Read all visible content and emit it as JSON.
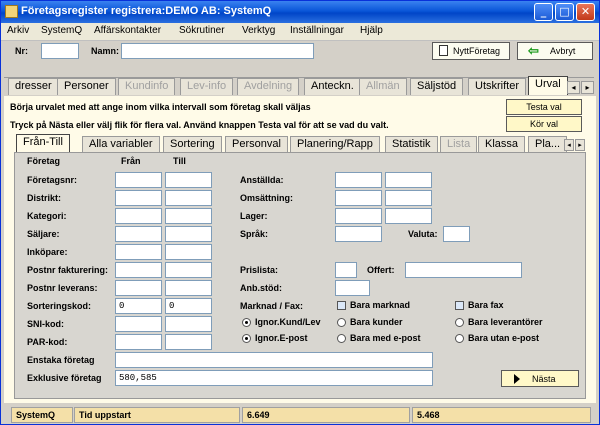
{
  "window": {
    "title": "Företagsregister registrera:DEMO AB: SystemQ"
  },
  "menu": [
    "Arkiv",
    "SystemQ",
    "Affärskontakter",
    "Sökrutiner",
    "Verktyg",
    "Inställningar",
    "Hjälp"
  ],
  "toolbar": {
    "nr_label": "Nr:",
    "namn_label": "Namn:",
    "nytt_label": "NyttFöretag",
    "avbryt_label": "Avbryt"
  },
  "main_tabs": [
    "dresser",
    "Personer",
    "Kundinfo",
    "Lev-info",
    "Avdelning",
    "Anteckn.",
    "Allmän",
    "Säljstöd",
    "Utskrifter",
    "Urval"
  ],
  "info": {
    "line1": "Börja urvalet med att ange inom vilka intervall som företag skall väljas",
    "line2": "Tryck på Nästa eller välj flik för flera val. Använd knappen Testa val för att se vad du valt.",
    "testa_label": "Testa val",
    "kor_label": "Kör val"
  },
  "sub_tabs": [
    "Från-Till",
    "Alla variabler",
    "Sortering",
    "Personval",
    "Planering/Rapp",
    "Statistik",
    "Lista",
    "Klassa",
    "Pla..."
  ],
  "headers": {
    "foretag": "Företag",
    "fran": "Från",
    "till": "Till"
  },
  "left_rows": [
    "Företagsnr:",
    "Distrikt:",
    "Kategori:",
    "Säljare:",
    "Inköpare:",
    "Postnr fakturering:",
    "Postnr leverans:",
    "Sorteringskod:",
    "SNI-kod:",
    "PAR-kod:"
  ],
  "sort_from": "0",
  "sort_to": "0",
  "right_rows": [
    "Anställda:",
    "Omsättning:",
    "Lager:",
    "Språk:"
  ],
  "valuta_label": "Valuta:",
  "prislista_label": "Prislista:",
  "offert_label": "Offert:",
  "anbstod_label": "Anb.stöd:",
  "marknad_label": "Marknad / Fax:",
  "options": {
    "bara_marknad": "Bara marknad",
    "bara_fax": "Bara fax",
    "ignor_kund": "Ignor.Kund/Lev",
    "bara_kunder": "Bara kunder",
    "bara_lev": "Bara leverantörer",
    "ignor_epost": "Ignor.E-post",
    "bara_epost": "Bara med e-post",
    "bara_utan_epost": "Bara utan e-post"
  },
  "enstaka_label": "Enstaka företag",
  "exklusive_label": "Exklusive företag",
  "exklusive_value": "580,585",
  "nasta_label": "Nästa",
  "status": {
    "app": "SystemQ",
    "label": "Tid uppstart",
    "v1": "6.649",
    "v2": "5.468"
  }
}
